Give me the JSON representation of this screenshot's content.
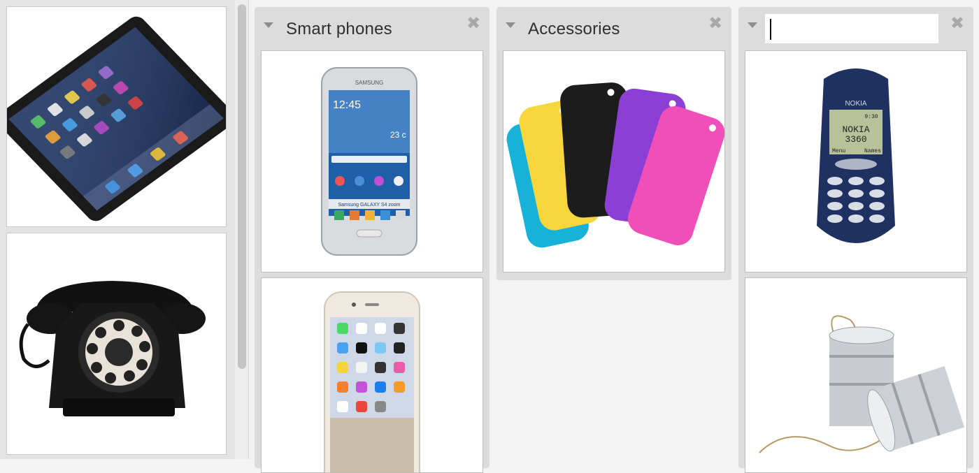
{
  "columns": [
    {
      "title": "Smart phones",
      "items": [
        "samsung-galaxy-s4-zoom",
        "iphone-6"
      ]
    },
    {
      "title": "Accessories",
      "items": [
        "silicone-phone-cases"
      ]
    },
    {
      "title": "",
      "title_placeholder": "",
      "items": [
        "nokia-3360",
        "tin-can-phone"
      ]
    }
  ],
  "phone_screen": {
    "samsung_brand": "SAMSUNG",
    "samsung_time": "12:45",
    "samsung_temp": "23 c",
    "samsung_model": "Samsung GALAXY S4 zoom",
    "nokia_brand": "NOKIA",
    "nokia_display_line1": "NOKIA",
    "nokia_display_line2": "3360",
    "nokia_menu": "Menu",
    "nokia_names": "Names",
    "nokia_time": "9:30"
  },
  "left_pane": {
    "items": [
      "ipad",
      "rotary-telephone"
    ]
  }
}
